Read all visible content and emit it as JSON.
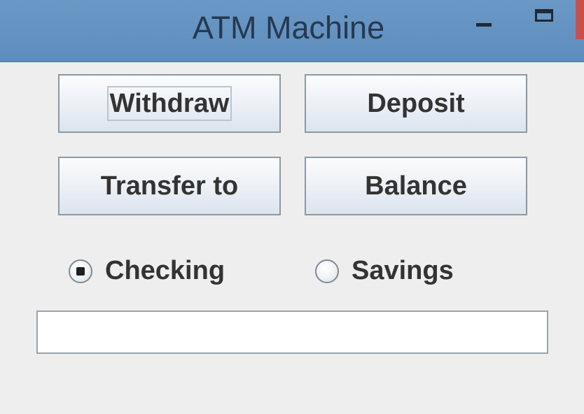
{
  "window": {
    "title": "ATM Machine"
  },
  "buttons": {
    "withdraw": "Withdraw",
    "deposit": "Deposit",
    "transfer": "Transfer to",
    "balance": "Balance"
  },
  "account_type": {
    "selected": "Checking",
    "options": [
      "Checking",
      "Savings"
    ]
  },
  "amount_field": {
    "value": ""
  },
  "colors": {
    "titlebar": "#5d8dbd",
    "close": "#c9504a"
  }
}
